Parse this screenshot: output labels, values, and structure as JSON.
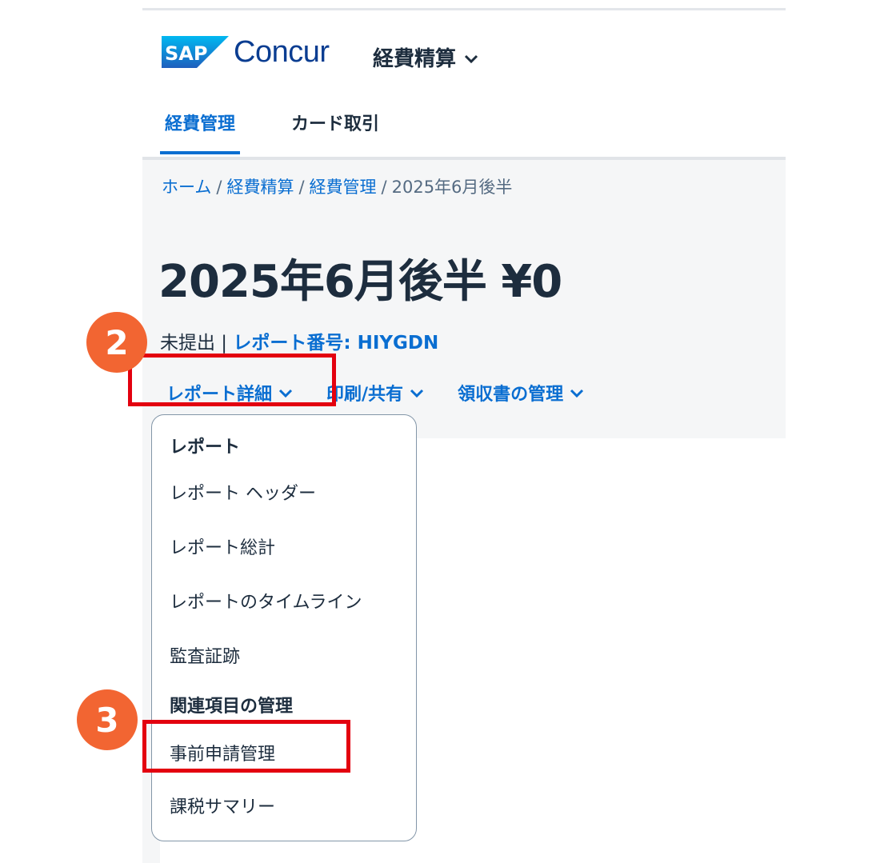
{
  "header": {
    "logo_sap": "SAP",
    "logo_concur": "Concur",
    "app_switcher_label": "経費精算"
  },
  "tabs": [
    {
      "label": "経費管理",
      "active": true
    },
    {
      "label": "カード取引",
      "active": false
    }
  ],
  "breadcrumb": {
    "home": "ホーム",
    "expense": "経費精算",
    "manage": "経費管理",
    "current": "2025年6月後半",
    "separator": "/"
  },
  "report": {
    "title": "2025年6月後半 ¥0",
    "status": "未提出",
    "status_divider": " | ",
    "report_number": "レポート番号: HIYGDN"
  },
  "actions": {
    "details": "レポート詳細",
    "print_share": "印刷/共有",
    "receipts": "領収書の管理"
  },
  "dropdown": {
    "heading_report": "レポート",
    "item_header": "レポート ヘッダー",
    "item_totals": "レポート総計",
    "item_timeline": "レポートのタイムライン",
    "item_audit": "監査証跡",
    "heading_related": "関連項目の管理",
    "item_preapproval": "事前申請管理",
    "item_tax": "課税サマリー"
  },
  "annotations": {
    "step2": "2",
    "step3": "3"
  },
  "colors": {
    "accent": "#0a6ed1",
    "brand_dark": "#0a3d91",
    "highlight_red": "#e3000f",
    "badge_orange": "#f26532"
  }
}
